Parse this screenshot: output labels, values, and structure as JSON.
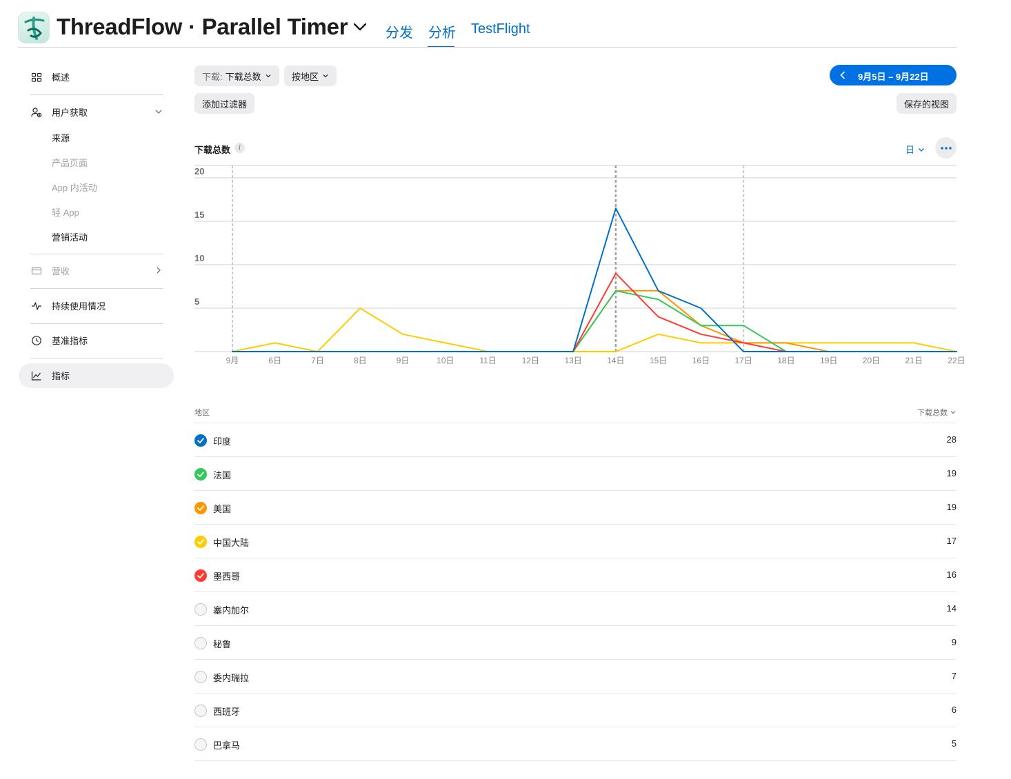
{
  "header": {
    "app_title": "ThreadFlow · Parallel Timer",
    "tabs": [
      {
        "label": "分发",
        "active": false
      },
      {
        "label": "分析",
        "active": true
      },
      {
        "label": "TestFlight",
        "active": false
      }
    ]
  },
  "sidebar": {
    "overview": "概述",
    "acquisition": "用户获取",
    "acquisition_items": [
      "来源",
      "产品页面",
      "App 内活动",
      "轻 App",
      "营销活动"
    ],
    "revenue": "营收",
    "engagement": "持续使用情况",
    "benchmarks": "基准指标",
    "metrics": "指标"
  },
  "toolbar": {
    "downloads_prefix": "下载:",
    "downloads_value": "下载总数",
    "by_region": "按地区",
    "add_filter": "添加过滤器",
    "date_range": "9月5日 – 9月22日",
    "saved_views": "保存的视图"
  },
  "chart_header": {
    "title": "下载总数",
    "info": "i",
    "period": "日"
  },
  "chart_data": {
    "type": "line",
    "categories": [
      "9月",
      "6日",
      "7日",
      "8日",
      "9日",
      "10日",
      "11日",
      "12日",
      "13日",
      "14日",
      "15日",
      "16日",
      "17日",
      "18日",
      "19日",
      "20日",
      "21日",
      "22日"
    ],
    "ylim": [
      0,
      20
    ],
    "yticks": [
      5,
      10,
      15,
      20
    ],
    "grid": true,
    "highlight_x": [
      "9月",
      "14日",
      "17日"
    ],
    "series": [
      {
        "name": "印度",
        "color": "#0070c9",
        "values": [
          0,
          0,
          0,
          0,
          0,
          0,
          0,
          0,
          0,
          16.5,
          7,
          5,
          0,
          0,
          0,
          0,
          0,
          0
        ]
      },
      {
        "name": "法国",
        "color": "#34c759",
        "values": [
          0,
          0,
          0,
          0,
          0,
          0,
          0,
          0,
          0,
          7,
          6,
          3,
          3,
          0,
          0,
          0,
          0,
          0
        ]
      },
      {
        "name": "美国",
        "color": "#ff9500",
        "values": [
          0,
          0,
          0,
          0,
          0,
          0,
          0,
          0,
          0,
          7,
          7,
          3,
          1,
          1,
          0,
          0,
          0,
          0
        ]
      },
      {
        "name": "中国大陆",
        "color": "#ffcc00",
        "values": [
          0,
          1,
          0,
          5,
          2,
          1,
          0,
          0,
          0,
          0,
          2,
          1,
          1,
          1,
          1,
          1,
          1,
          0
        ]
      },
      {
        "name": "墨西哥",
        "color": "#ff3b30",
        "values": [
          0,
          0,
          0,
          0,
          0,
          0,
          0,
          0,
          0,
          9,
          4,
          2,
          1,
          0,
          0,
          0,
          0,
          0
        ]
      }
    ]
  },
  "table": {
    "col_region": "地区",
    "col_downloads": "下载总数",
    "rows": [
      {
        "name": "印度",
        "value": "28",
        "checked": true,
        "color": "#0070c9"
      },
      {
        "name": "法国",
        "value": "19",
        "checked": true,
        "color": "#34c759"
      },
      {
        "name": "美国",
        "value": "19",
        "checked": true,
        "color": "#ff9500"
      },
      {
        "name": "中国大陆",
        "value": "17",
        "checked": true,
        "color": "#ffcc00"
      },
      {
        "name": "墨西哥",
        "value": "16",
        "checked": true,
        "color": "#ff3b30"
      },
      {
        "name": "塞内加尔",
        "value": "14",
        "checked": false,
        "color": ""
      },
      {
        "name": "秘鲁",
        "value": "9",
        "checked": false,
        "color": ""
      },
      {
        "name": "委内瑞拉",
        "value": "7",
        "checked": false,
        "color": ""
      },
      {
        "name": "西班牙",
        "value": "6",
        "checked": false,
        "color": ""
      },
      {
        "name": "巴拿马",
        "value": "5",
        "checked": false,
        "color": ""
      }
    ]
  }
}
